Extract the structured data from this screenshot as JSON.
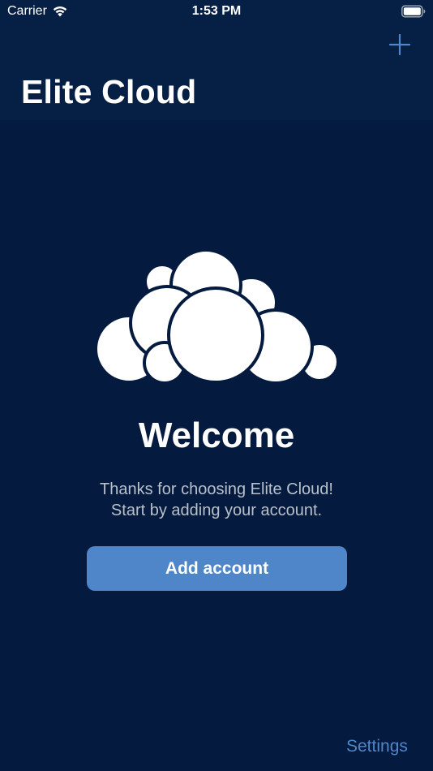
{
  "status_bar": {
    "carrier": "Carrier",
    "time": "1:53 PM",
    "wifi_icon": "wifi-icon",
    "battery_icon": "battery-icon"
  },
  "header": {
    "title": "Elite Cloud",
    "add_icon": "plus-icon"
  },
  "main": {
    "logo_icon": "cloud-logo",
    "welcome": "Welcome",
    "message_line1": "Thanks for choosing Elite Cloud!",
    "message_line2": "Start by adding your account.",
    "add_account_label": "Add account"
  },
  "footer": {
    "settings_label": "Settings"
  },
  "colors": {
    "background": "#041B3F",
    "header_background": "#061F45",
    "accent": "#4F86C9",
    "message_text": "#B9C0CA"
  }
}
